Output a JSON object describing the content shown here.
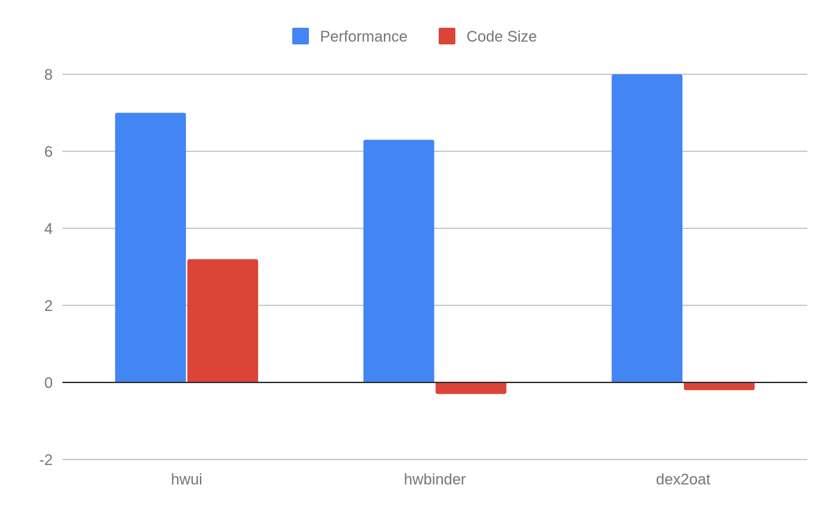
{
  "chart_data": {
    "type": "bar",
    "title": "",
    "xlabel": "",
    "ylabel": "",
    "categories": [
      "hwui",
      "hwbinder",
      "dex2oat"
    ],
    "series": [
      {
        "name": "Performance",
        "color": "#4285f4",
        "values": [
          7.0,
          6.3,
          8.0
        ]
      },
      {
        "name": "Code Size",
        "color": "#db4437",
        "values": [
          3.2,
          -0.3,
          -0.2
        ]
      }
    ],
    "ylim": [
      -2,
      8
    ],
    "yticks": [
      -2,
      0,
      2,
      4,
      6,
      8
    ],
    "ytick_labels": [
      "-2",
      "0",
      "2",
      "4",
      "6",
      "8"
    ],
    "grid": true,
    "legend_position": "top-center"
  }
}
